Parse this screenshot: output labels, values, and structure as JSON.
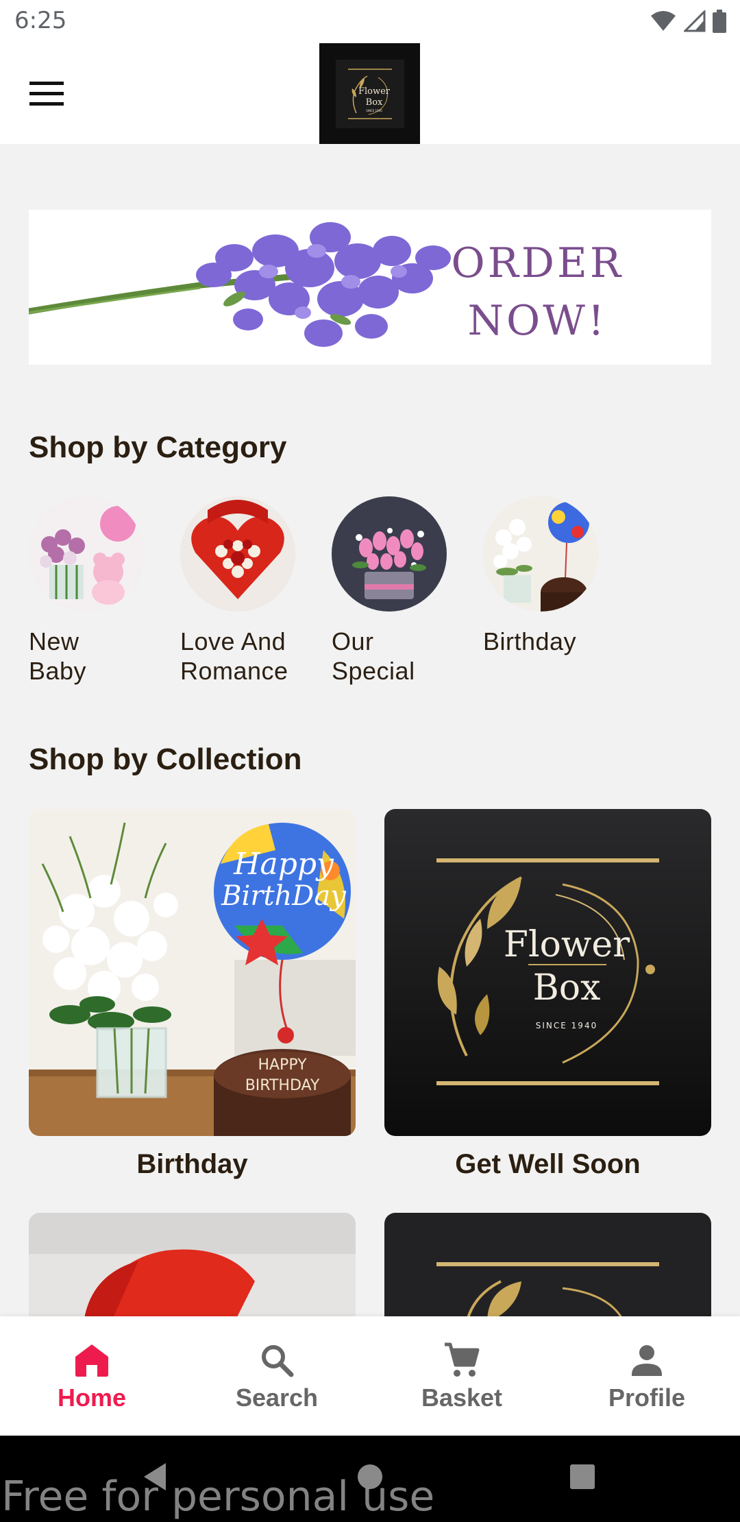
{
  "status_bar": {
    "time": "6:25"
  },
  "header": {
    "logo_line1": "Flower",
    "logo_line2": "Box",
    "logo_since": "SINCE 1940"
  },
  "banner": {
    "line1": "ORDER",
    "line2": "NOW!"
  },
  "categories": {
    "title": "Shop by Category",
    "items": [
      {
        "label": "New\nBaby"
      },
      {
        "label": "Love And\nRomance"
      },
      {
        "label": "Our\nSpecial"
      },
      {
        "label": "Birthday"
      }
    ]
  },
  "collections": {
    "title": "Shop by Collection",
    "items": [
      {
        "label": "Birthday",
        "balloon_text": "Happy BirthDay",
        "cake_text": "HAPPY BIRTHDAY"
      },
      {
        "label": "Get Well Soon"
      }
    ]
  },
  "bottom_nav": {
    "items": [
      {
        "label": "Home",
        "icon": "home-icon",
        "active": true
      },
      {
        "label": "Search",
        "icon": "search-icon",
        "active": false
      },
      {
        "label": "Basket",
        "icon": "cart-icon",
        "active": false
      },
      {
        "label": "Profile",
        "icon": "person-icon",
        "active": false
      }
    ]
  },
  "watermark": "Free for personal use",
  "colors": {
    "accent": "#ee1c4e",
    "banner_text": "#7a4d8d",
    "gold": "#c9a85a"
  }
}
